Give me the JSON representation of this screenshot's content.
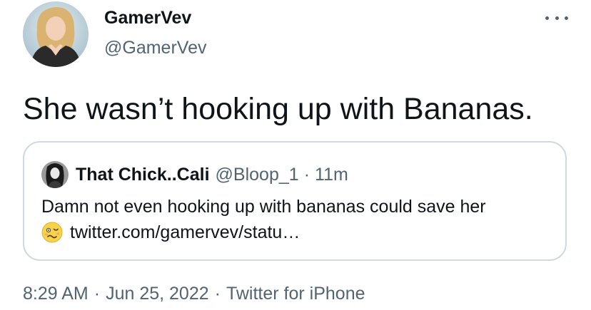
{
  "author": {
    "name": "GamerVev",
    "handle": "@GamerVev"
  },
  "tweet": {
    "text": "She wasn’t hooking up with Bananas."
  },
  "quoted_tweet": {
    "name": "That Chick..Cali",
    "handle": "@Bloop_1",
    "separator": "·",
    "time": "11m",
    "line1": "Damn not even hooking up with bananas could save her",
    "emoji_icon": "woozy-face-emoji",
    "link": "twitter.com/gamervev/statu…"
  },
  "meta": {
    "time": "8:29 AM",
    "separator": "·",
    "date": "Jun 25, 2022",
    "source": "Twitter for iPhone"
  },
  "icons": {
    "more": "more-horizontal-icon"
  },
  "colors": {
    "text": "#0f1419",
    "secondary": "#536471",
    "border": "#cfd9de"
  }
}
